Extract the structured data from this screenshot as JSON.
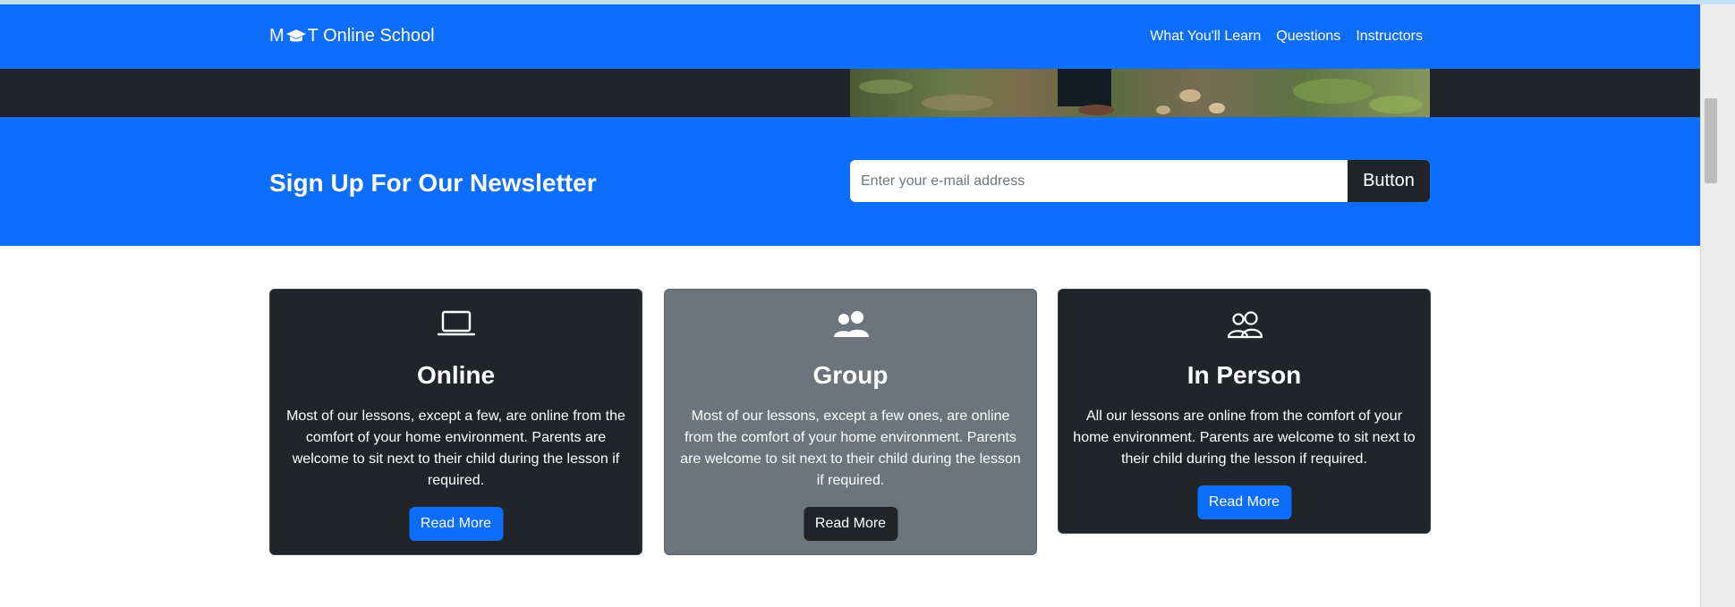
{
  "navbar": {
    "brand_text": "M T Online School",
    "links": [
      "What You'll Learn",
      "Questions",
      "Instructors"
    ]
  },
  "newsletter": {
    "title": "Sign Up For Our Newsletter",
    "input_placeholder": "Enter your e-mail address",
    "button_label": "Button"
  },
  "cards": [
    {
      "icon": "laptop-icon",
      "title": "Online",
      "text": "Most of our lessons, except a few, are online from the comfort of your home environment. Parents are welcome to sit next to their child during the lesson if required.",
      "button": "Read More"
    },
    {
      "icon": "people-fill-icon",
      "title": "Group",
      "text": "Most of our lessons, except a few ones, are online from the comfort of your home environment. Parents are welcome to sit next to their child during the lesson if required.",
      "button": "Read More"
    },
    {
      "icon": "people-outline-icon",
      "title": "In Person",
      "text": "All our lessons are online from the comfort of your home environment. Parents are welcome to sit next to their child during the lesson if required.",
      "button": "Read More"
    }
  ],
  "colors": {
    "primary": "#0d6efd",
    "dark": "#212529",
    "secondary": "#6c757d"
  }
}
